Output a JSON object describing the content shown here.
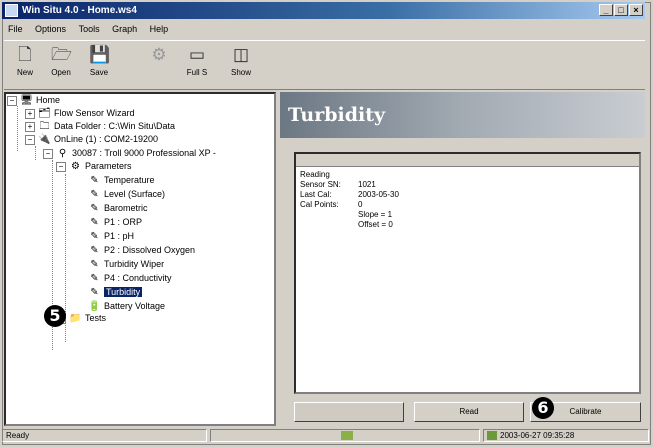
{
  "window": {
    "title": "Win Situ 4.0 - Home.ws4",
    "caption_buttons": [
      "_",
      "□",
      "×"
    ]
  },
  "menu": [
    "File",
    "Options",
    "Tools",
    "Graph",
    "Help"
  ],
  "toolbar": [
    {
      "label": "New",
      "icon": "new-icon",
      "glyph": "🗋",
      "enabled": true
    },
    {
      "label": "Open",
      "icon": "open-icon",
      "glyph": "🗁",
      "enabled": true
    },
    {
      "label": "Save",
      "icon": "save-icon",
      "glyph": "💾",
      "enabled": true
    },
    {
      "label": "",
      "icon": "disabled-tool-icon",
      "glyph": "⚙",
      "enabled": false
    },
    {
      "label": "Full S",
      "icon": "full-screen-icon",
      "glyph": "▭",
      "enabled": true
    },
    {
      "label": "Show",
      "icon": "show-icon",
      "glyph": "◫",
      "enabled": true
    }
  ],
  "tree": {
    "home": "Home",
    "flow_sensor_wizard": "Flow Sensor Wizard",
    "data_folder": "Data Folder : C:\\Win Situ\\Data",
    "online": "OnLine (1) : COM2-19200",
    "device": "30087 : Troll 9000 Professional XP -",
    "parameters": "Parameters",
    "params": [
      "Temperature",
      "Level (Surface)",
      "Barometric",
      "P1 : ORP",
      "P1 : pH",
      "P2 : Dissolved Oxygen",
      "Turbidity Wiper",
      "P4 : Conductivity",
      "Turbidity",
      "Battery Voltage"
    ],
    "selected_index": 8,
    "tests": "Tests"
  },
  "callouts": {
    "five": "5",
    "six": "6"
  },
  "detail": {
    "banner_title": "Turbidity",
    "reading_label": "Reading",
    "sensor_sn_label": "Sensor SN:",
    "sensor_sn": "1021",
    "last_cal_label": "Last Cal:",
    "last_cal": "2003-05-30",
    "cal_points_label": "Cal Points:",
    "cal_points": "0",
    "slope": "Slope = 1",
    "offset": "Offset = 0"
  },
  "buttons": {
    "disabled_label": "",
    "read": "Read",
    "calibrate": "Calibrate"
  },
  "status": {
    "left": "Ready",
    "datetime": "2003-06-27  09:35:28"
  }
}
